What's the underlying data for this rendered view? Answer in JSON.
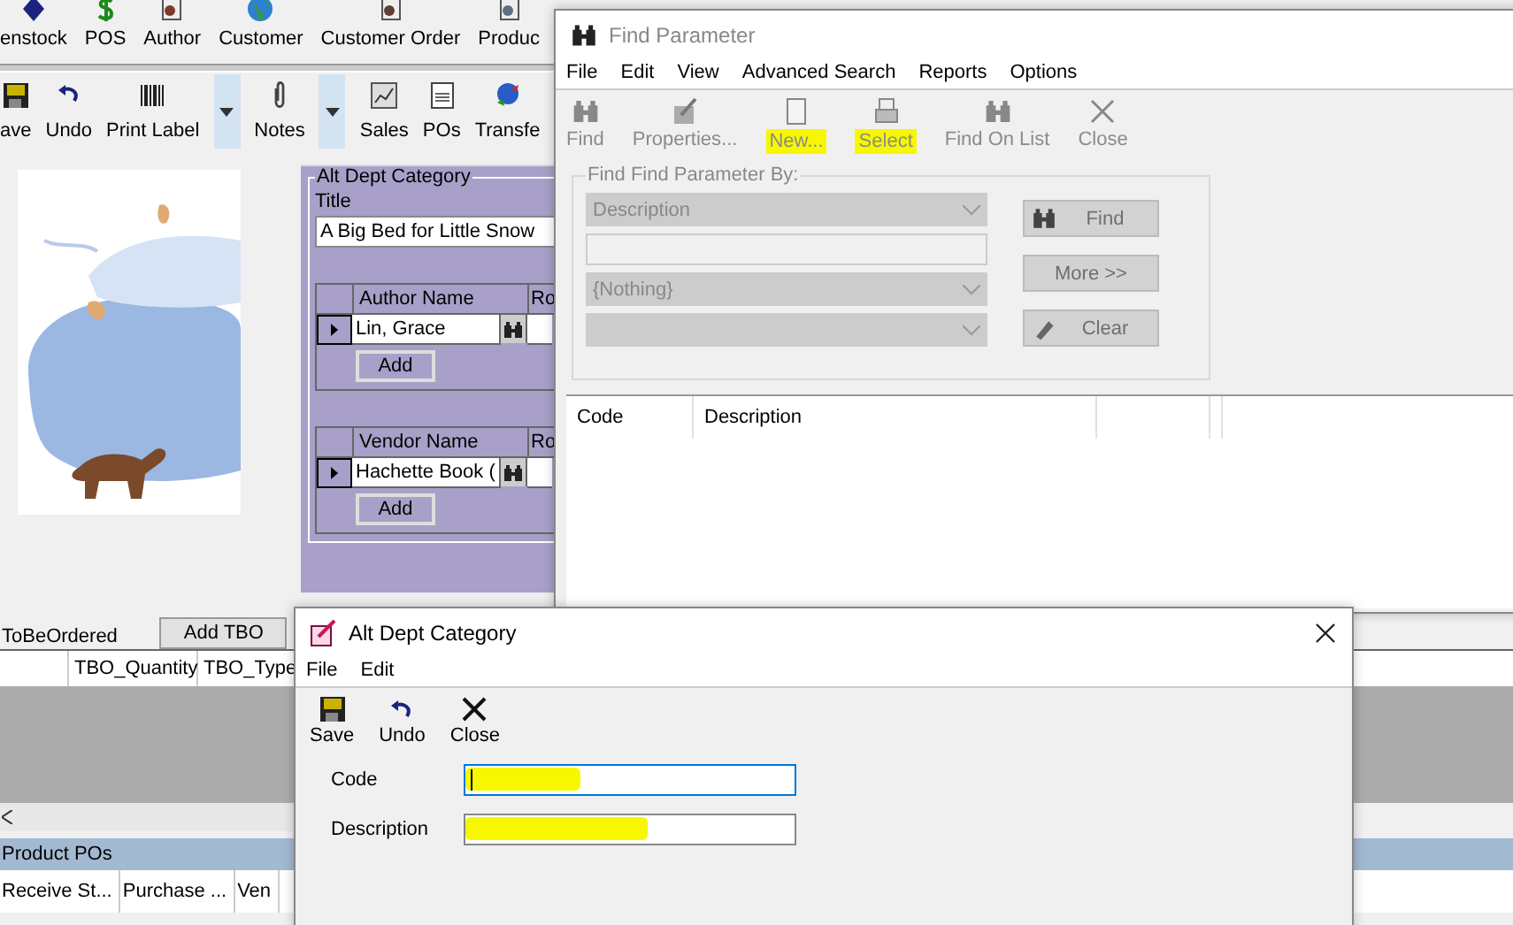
{
  "main_toolbar": [
    {
      "label": "enstock"
    },
    {
      "label": "POS"
    },
    {
      "label": "Author"
    },
    {
      "label": "Customer"
    },
    {
      "label": "Customer Order"
    },
    {
      "label": "Produc"
    }
  ],
  "record_toolbar": [
    {
      "kind": "button",
      "label": "ave"
    },
    {
      "kind": "button",
      "label": "Undo"
    },
    {
      "kind": "button",
      "label": "Print Label"
    },
    {
      "kind": "dropdown"
    },
    {
      "kind": "button",
      "label": "Notes"
    },
    {
      "kind": "dropdown"
    },
    {
      "kind": "button",
      "label": "Sales"
    },
    {
      "kind": "button",
      "label": "POs"
    },
    {
      "kind": "button",
      "label": "Transfe"
    }
  ],
  "alt_dept_panel": {
    "legend": "Alt Dept Category",
    "title_label": "Title",
    "title_value": "A Big Bed for Little Snow",
    "grids": [
      {
        "column_1": "Author Name",
        "column_2": "Ro",
        "value": "Lin, Grace",
        "add_button": "Add"
      },
      {
        "column_1": "Vendor Name",
        "column_2": "Ro",
        "value": "Hachette Book (",
        "add_button": "Add"
      }
    ]
  },
  "to_be_ordered": {
    "label": "ToBeOrdered",
    "add_button": "Add TBO",
    "columns": [
      "TBO_Quantity",
      "TBO_Type"
    ]
  },
  "product_pos": {
    "title": "Product POs",
    "columns": [
      "Receive St...",
      "Purchase ...",
      "Ven"
    ]
  },
  "find_window": {
    "title": "Find Parameter",
    "menu": [
      "File",
      "Edit",
      "View",
      "Advanced Search",
      "Reports",
      "Options"
    ],
    "toolbar": [
      {
        "label": "Find",
        "disabled": true,
        "highlighted": false
      },
      {
        "label": "Properties...",
        "disabled": true,
        "highlighted": false
      },
      {
        "label": "New...",
        "disabled": true,
        "highlighted": true
      },
      {
        "label": "Select",
        "disabled": true,
        "highlighted": true
      },
      {
        "label": "Find On List",
        "disabled": true,
        "highlighted": false
      },
      {
        "label": "Close",
        "disabled": true,
        "highlighted": false
      }
    ],
    "group_legend": "Find Find Parameter By:",
    "criteria": [
      {
        "kind": "dropdown",
        "value": "Description"
      },
      {
        "kind": "text"
      },
      {
        "kind": "dropdown",
        "value": "{Nothing}"
      },
      {
        "kind": "dropdown"
      }
    ],
    "buttons": [
      "Find",
      "More >>",
      "Clear"
    ],
    "columns": [
      "Code",
      "Description"
    ]
  },
  "edit_window": {
    "title": "Alt Dept Category",
    "menu": [
      "File",
      "Edit"
    ],
    "toolbar": [
      "Save",
      "Undo",
      "Close"
    ],
    "fields": [
      {
        "label": "Code",
        "focused": true,
        "highlighted": true
      },
      {
        "label": "Description",
        "focused": false,
        "highlighted": true
      }
    ]
  }
}
